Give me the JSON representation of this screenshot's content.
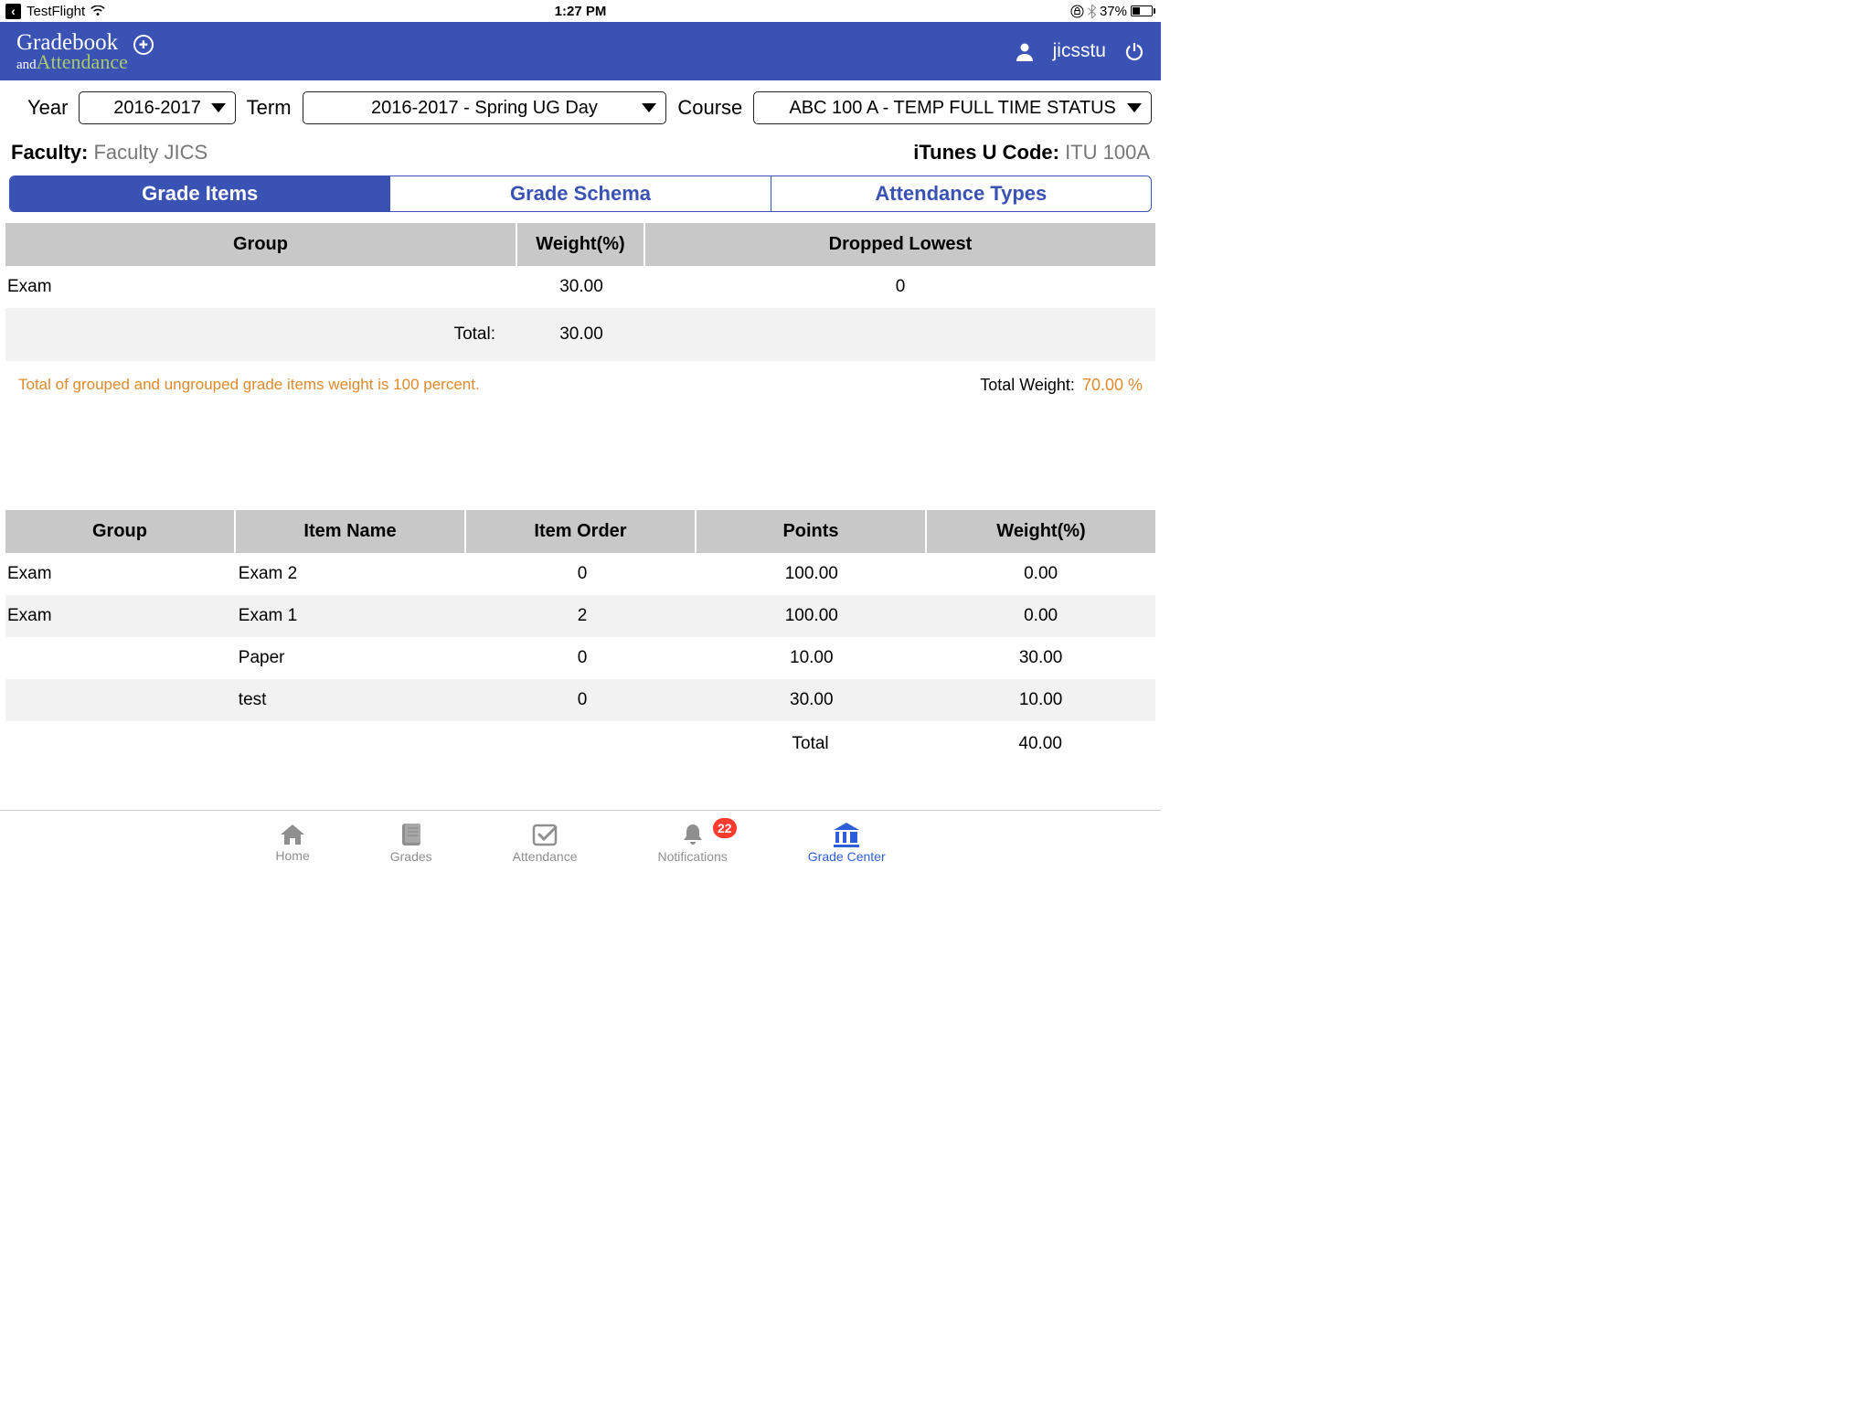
{
  "status": {
    "app_name": "TestFlight",
    "time": "1:27 PM",
    "battery": "37%"
  },
  "header": {
    "logo_line1": "Gradebook",
    "logo_and": "and",
    "logo_att": "Attendance",
    "user": "jicsstu"
  },
  "filters": {
    "year_label": "Year",
    "year_value": "2016-2017",
    "term_label": "Term",
    "term_value": "2016-2017 - Spring UG Day",
    "course_label": "Course",
    "course_value": "ABC  100  A - TEMP FULL TIME STATUS"
  },
  "info": {
    "faculty_label": "Faculty:",
    "faculty_value": " Faculty JICS",
    "itunes_label": "iTunes U Code:",
    "itunes_value": " ITU 100A"
  },
  "tabs": {
    "t1": "Grade Items",
    "t2": "Grade Schema",
    "t3": "Attendance Types"
  },
  "group_table": {
    "h1": "Group",
    "h2": "Weight(%)",
    "h3": "Dropped Lowest",
    "row1_group": "Exam",
    "row1_weight": "30.00",
    "row1_dropped": "0",
    "total_label": "Total:",
    "total_weight": "30.00"
  },
  "notes": {
    "left": "Total of grouped and ungrouped grade items weight is 100 percent.",
    "right_label": "Total Weight:",
    "right_pct": "70.00 %"
  },
  "items_table": {
    "h1": "Group",
    "h2": "Item Name",
    "h3": "Item Order",
    "h4": "Points",
    "h5": "Weight(%)",
    "rows": [
      {
        "g": "Exam",
        "n": "Exam 2",
        "o": "0",
        "p": "100.00",
        "w": "0.00"
      },
      {
        "g": "Exam",
        "n": "Exam 1",
        "o": "2",
        "p": "100.00",
        "w": "0.00"
      },
      {
        "g": "",
        "n": "Paper",
        "o": "0",
        "p": "10.00",
        "w": "30.00"
      },
      {
        "g": "",
        "n": "test",
        "o": "0",
        "p": "30.00",
        "w": "10.00"
      }
    ],
    "total_label": "Total",
    "total_weight": "40.00"
  },
  "nav": {
    "home": "Home",
    "grades": "Grades",
    "attendance": "Attendance",
    "notifications": "Notifications",
    "gradecenter": "Grade Center",
    "badge": "22"
  }
}
